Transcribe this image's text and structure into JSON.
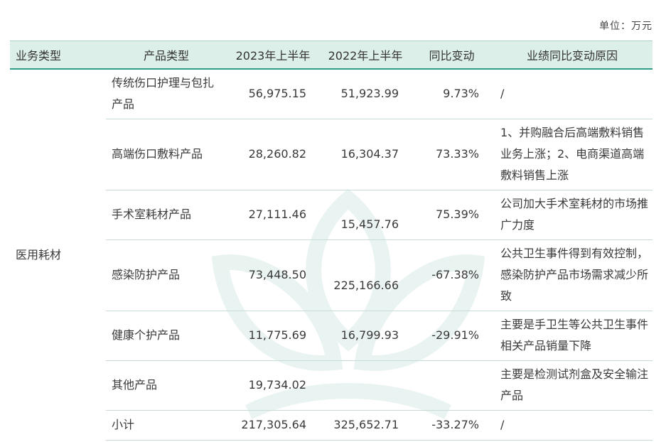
{
  "unit_label": "单位：万元",
  "headers": [
    "业务类型",
    "产品类型",
    "2023年上半年",
    "2022年上半年",
    "同比变动",
    "业绩同比变动原因"
  ],
  "category": "医用耗材",
  "rows": [
    {
      "product": "传统伤口护理与包扎产品",
      "y2023": "56,975.15",
      "y2022": "51,923.99",
      "change": "9.73%",
      "reason": "/"
    },
    {
      "product": "高端伤口敷料产品",
      "y2023": "28,260.82",
      "y2022": "16,304.37",
      "change": "73.33%",
      "reason": "1、并购融合后高端敷料销售业务上涨；2、电商渠道高端敷料销售上涨"
    },
    {
      "product": "手术室耗材产品",
      "y2023": "27,111.46",
      "y2022": "15,457.76",
      "change": "75.39%",
      "reason": "公司加大手术室耗材的市场推广力度"
    },
    {
      "product": "感染防护产品",
      "y2023": "73,448.50",
      "y2022": "225,166.66",
      "change": "-67.38%",
      "reason": "公共卫生事件得到有效控制，感染防护产品市场需求减少所致"
    },
    {
      "product": "健康个护产品",
      "y2023": "11,775.69",
      "y2022": "16,799.93",
      "change": "-29.91%",
      "reason": "主要是手卫生等公共卫生事件相关产品销量下降"
    },
    {
      "product": "其他产品",
      "y2023": "19,734.02",
      "y2022": "",
      "change": "",
      "reason": "主要是检测试剂盒及安全输注产品"
    },
    {
      "product": "小计",
      "y2023": "217,305.64",
      "y2022": "325,652.71",
      "change": "-33.27%",
      "reason": "/"
    }
  ]
}
